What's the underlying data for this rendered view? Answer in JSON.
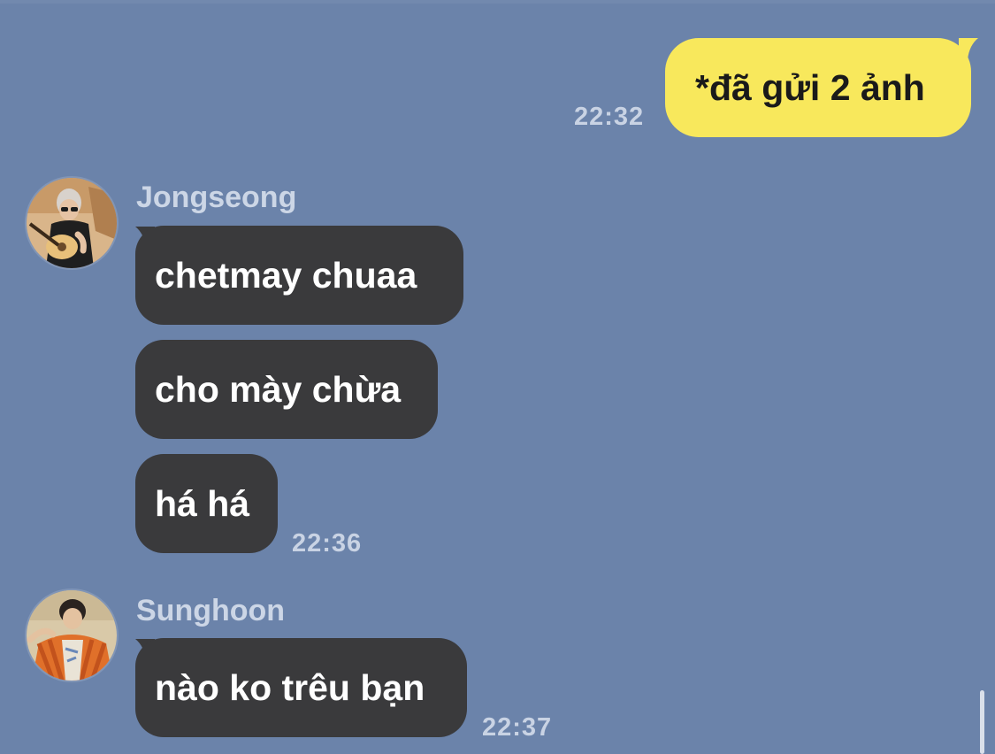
{
  "colors": {
    "background": "#6b83aa",
    "incoming_bubble": "#3a3a3c",
    "outgoing_bubble": "#f8e85c",
    "timestamp": "#c9d3e4",
    "sender_name": "#ccd6e6"
  },
  "messages": {
    "outgoing": {
      "text": "*đã gửi 2 ảnh",
      "time": "22:32"
    },
    "jongseong": {
      "sender": "Jongseong",
      "avatar_icon": "avatar-photo-guitar",
      "bubbles": [
        {
          "text": "chetmay chuaa"
        },
        {
          "text": "cho mày chừa"
        },
        {
          "text": "há há"
        }
      ],
      "time": "22:36"
    },
    "sunghoon": {
      "sender": "Sunghoon",
      "avatar_icon": "avatar-photo-orange-jacket",
      "bubbles": [
        {
          "text": "nào ko trêu bạn"
        }
      ],
      "time": "22:37"
    }
  }
}
